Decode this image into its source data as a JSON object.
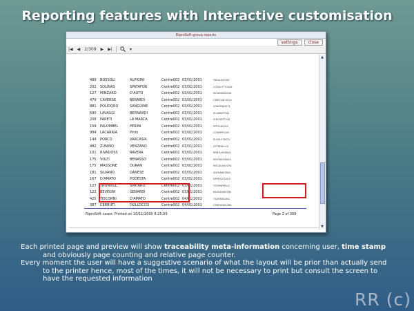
{
  "slide": {
    "title": "Reporting features with Interactive customisation",
    "watermark": "RR (c)"
  },
  "window": {
    "title": "RiproSoft group reports",
    "buttons": {
      "settings": "settings",
      "close": "close"
    }
  },
  "toolbar": {
    "first": "|◀",
    "prev": "◀",
    "page_indicator": "2/309",
    "next": "▶",
    "last": "▶|",
    "zoom_icon": "magnifier-icon",
    "zoom_dropdown": "▾"
  },
  "report": {
    "rows": [
      {
        "num": "489",
        "surname": "BOSSOLI",
        "name": "ALPIGINI",
        "centre": "Centre002",
        "date": "03/01/2001",
        "code": "FBSGLBJCNSF"
      },
      {
        "num": "202",
        "surname": "SOLINAS",
        "name": "SPATAFOR",
        "centre": "Centre002",
        "date": "03/01/2001",
        "code": "LCRDLOTTOSSE"
      },
      {
        "num": "127",
        "surname": "MINZARD",
        "name": "D'AUTO",
        "centre": "Centre002",
        "date": "03/01/2001",
        "code": "MCNINDBDS06"
      },
      {
        "num": "479",
        "surname": "CAVERSE",
        "name": "BERARDI",
        "centre": "Centre002",
        "date": "03/01/2001",
        "code": "CBRLTLBCVS24"
      },
      {
        "num": "881",
        "surname": "POLIDORO",
        "name": "SANGUINE",
        "centre": "Centre002",
        "date": "03/01/2001",
        "code": "SGNGBNNS74"
      },
      {
        "num": "690",
        "surname": "LAVAGGI",
        "name": "BERNARDI",
        "centre": "Centre002",
        "date": "03/01/2001",
        "code": "RLSDBSTTW1"
      },
      {
        "num": "208",
        "surname": "PARETI",
        "name": "LA MARCA",
        "centre": "Centre002",
        "date": "03/01/2001",
        "code": "PLBGSBTTLYB"
      },
      {
        "num": "159",
        "surname": "PALOMBEL",
        "name": "PERINI",
        "centre": "Centre002",
        "date": "03/01/2001",
        "code": "PPPSCBS01E"
      },
      {
        "num": "904",
        "surname": "LACARRIA",
        "name": "Pinto",
        "centre": "Centre002",
        "date": "03/01/2001",
        "code": "LCNMPRS193"
      },
      {
        "num": "144",
        "surname": "PORCO",
        "name": "VARCASIA",
        "centre": "Centre002",
        "date": "03/01/2001",
        "code": "PLANLSTBSTV"
      },
      {
        "num": "482",
        "surname": "ZUNINO",
        "name": "VENZANO",
        "centre": "Centre002",
        "date": "03/01/2001",
        "code": "ZSTBDRLS01"
      },
      {
        "num": "101",
        "surname": "RIVADOSS",
        "name": "RAVERA",
        "centre": "Centre002",
        "date": "03/01/2001",
        "code": "RRBTLMSDBLV"
      },
      {
        "num": "175",
        "surname": "VOLTI",
        "name": "BENASSO",
        "centre": "Centre002",
        "date": "03/01/2001",
        "code": "RDVBSDSNALS"
      },
      {
        "num": "175",
        "surname": "MASSONE",
        "name": "DURAN",
        "centre": "Centre002",
        "date": "03/01/2001",
        "code": "MSCDLNVLSPD"
      },
      {
        "num": "181",
        "surname": "SILVANO",
        "name": "DANESE",
        "centre": "Centre002",
        "date": "03/01/2001",
        "code": "SDFNSBSTDSS"
      },
      {
        "num": "167",
        "surname": "D'AMATO",
        "name": "PODESTA",
        "centre": "Centre002",
        "date": "03/01/2001",
        "code": "DPPESDTSALS"
      },
      {
        "num": "127",
        "surname": "TRONVILL",
        "name": "SPATARO",
        "centre": "Centre002",
        "date": "03/01/2001",
        "code": "TSTMNPMSLS"
      },
      {
        "num": "122",
        "surname": "BEVEGNI",
        "name": "GERARDI",
        "centre": "Centre002",
        "date": "03/01/2001",
        "code": "BSGDNSNSTBS"
      },
      {
        "num": "425",
        "surname": "TISCORNI",
        "name": "D'AMATO",
        "centre": "Centre002",
        "date": "04/01/2001",
        "code": "TSDFBBSLBSL"
      },
      {
        "num": "387",
        "surname": "CERRUTI",
        "name": "DOLLOCCO",
        "centre": "Centre002",
        "date": "04/01/2001",
        "code": "CRRDSDR1SBS"
      }
    ],
    "footer_left": "RiproSoft cases: Printed on 10/11/2000 8.25.09",
    "footer_right": "Page 2 of 309"
  },
  "caption": {
    "p1_a": "Each printed page and preview will show ",
    "p1_b": "traceability meta-information",
    "p1_c": " concerning user, ",
    "p1_d": "time stamp",
    "p1_e": "and obviously page counting and relative page counter.",
    "p2_a": "Every moment the user will have a suggestive scenario of what the layout will be prior than actually send",
    "p2_b": "to the printer hence, most of the times, it will not be necessary to print but consult the screen to",
    "p2_c": "have the requested information"
  },
  "colors": {
    "highlight": "#d41b1b",
    "footer_rule": "#3344aa",
    "title_text": "#ffffff"
  }
}
